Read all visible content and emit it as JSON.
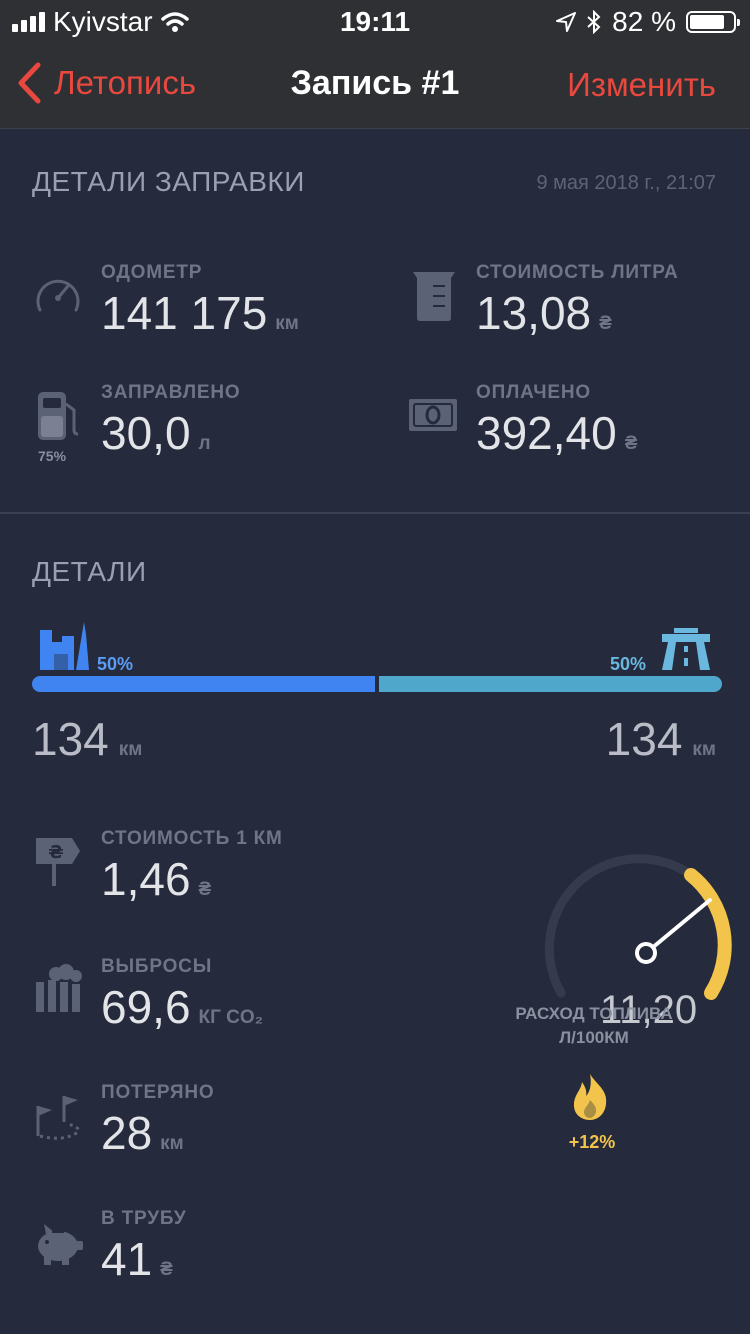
{
  "status_bar": {
    "carrier": "Kyivstar",
    "time": "19:11",
    "battery_percent": "82 %",
    "battery_fill_fraction": 0.82
  },
  "nav": {
    "back_label": "Летопись",
    "title": "Запись #1",
    "edit_label": "Изменить"
  },
  "refuel": {
    "section_title": "ДЕТАЛИ ЗАПРАВКИ",
    "date": "9 мая 2018 г., 21:07",
    "odometer": {
      "label": "ОДОМЕТР",
      "value": "141 175",
      "unit": "км"
    },
    "price_per_liter": {
      "label": "СТОИМОСТЬ ЛИТРА",
      "value": "13,08",
      "unit": "₴"
    },
    "filled": {
      "label": "ЗАПРАВЛЕНО",
      "value": "30,0",
      "unit": "л",
      "tank_percent": "75%"
    },
    "paid": {
      "label": "ОПЛАЧЕНО",
      "value": "392,40",
      "unit": "₴"
    }
  },
  "details": {
    "section_title": "ДЕТАЛИ",
    "city": {
      "percent": "50%",
      "km": "134",
      "unit": "км",
      "fraction": 0.5,
      "color": "#3f84f0"
    },
    "highway": {
      "percent": "50%",
      "km": "134",
      "unit": "км",
      "fraction": 0.5,
      "color": "#4fa7cc"
    },
    "cost_per_km": {
      "label": "СТОИМОСТЬ 1 КМ",
      "value": "1,46",
      "unit": "₴"
    },
    "emissions": {
      "label": "ВЫБРОСЫ",
      "value": "69,6",
      "unit": "КГ CO₂"
    },
    "lost": {
      "label": "ПОТЕРЯНО",
      "value": "28",
      "unit": "км"
    },
    "wasted": {
      "label": "В ТРУБУ",
      "value": "41",
      "unit": "₴"
    },
    "consumption": {
      "value": "11,20",
      "label_line1": "РАСХОД ТОПЛИВА",
      "label_line2": "Л/100КМ",
      "delta": "+12%",
      "accent_color": "#f2c44c"
    }
  }
}
